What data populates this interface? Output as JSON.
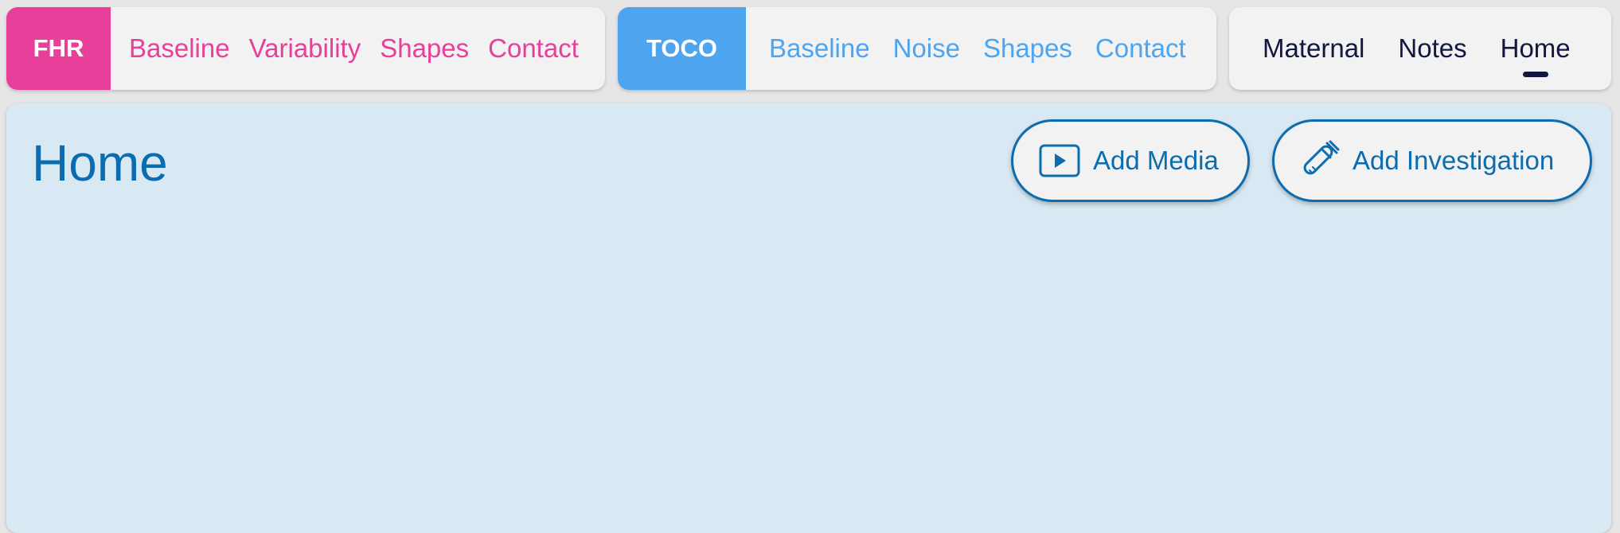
{
  "fhr": {
    "tag": "FHR",
    "tabs": [
      "Baseline",
      "Variability",
      "Shapes",
      "Contact"
    ]
  },
  "toco": {
    "tag": "TOCO",
    "tabs": [
      "Baseline",
      "Noise",
      "Shapes",
      "Contact"
    ]
  },
  "nav": {
    "tabs": [
      "Maternal",
      "Notes",
      "Home"
    ],
    "active": "Home"
  },
  "main": {
    "title": "Home",
    "add_media_label": "Add Media",
    "add_investigation_label": "Add Investigation"
  },
  "icons": {
    "add_media": "play-icon",
    "add_investigation": "test-tube-icon"
  },
  "colors": {
    "fhr": "#e8409a",
    "toco": "#4da5f0",
    "nav_text": "#12173f",
    "accent": "#0b6cb0",
    "panel_bg": "#d9e9f3"
  }
}
